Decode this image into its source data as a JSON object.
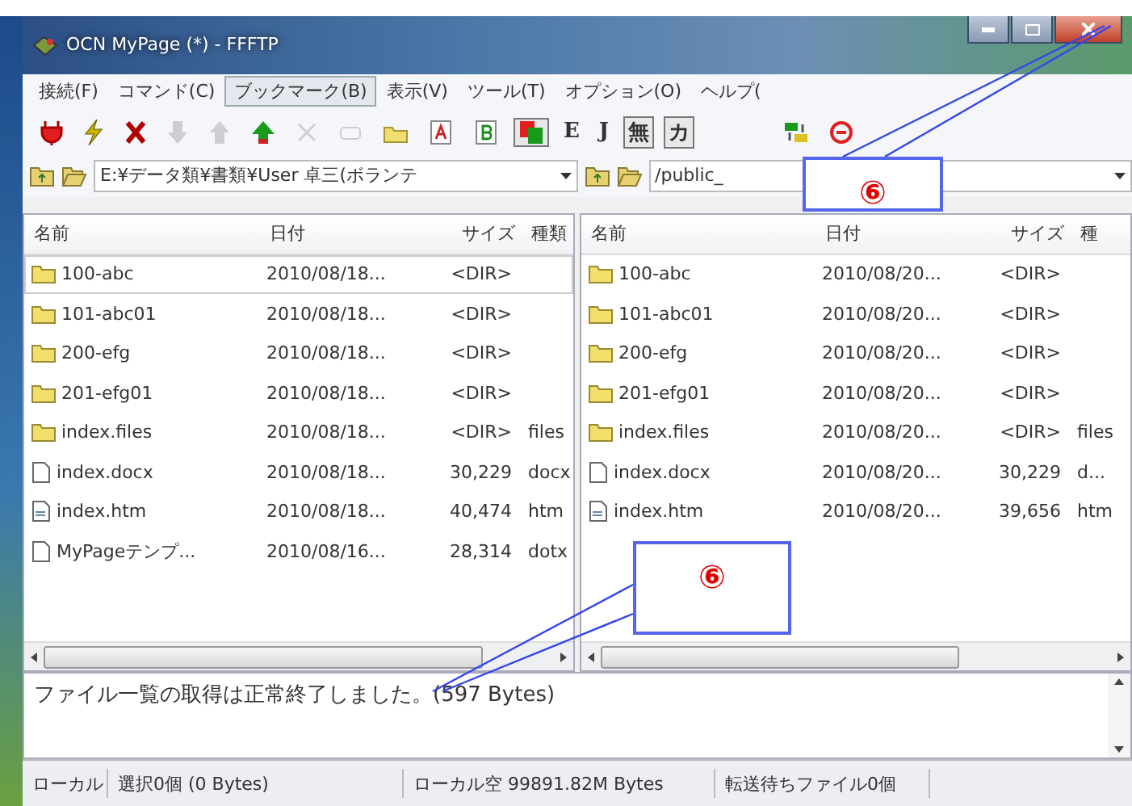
{
  "window": {
    "title": "OCN MyPage (*) - FFFTP"
  },
  "menu": [
    {
      "label": "接続(F)",
      "selected": false
    },
    {
      "label": "コマンド(C)",
      "selected": false
    },
    {
      "label": "ブックマーク(B)",
      "selected": true
    },
    {
      "label": "表示(V)",
      "selected": false
    },
    {
      "label": "ツール(T)",
      "selected": false
    },
    {
      "label": "オプション(O)",
      "selected": false
    },
    {
      "label": "ヘルプ(",
      "selected": false
    }
  ],
  "toolbar": [
    {
      "kind": "connect",
      "disabled": false,
      "pressed": false
    },
    {
      "kind": "quick",
      "disabled": false,
      "pressed": false
    },
    {
      "kind": "disconnect",
      "disabled": false,
      "pressed": false
    },
    {
      "kind": "download",
      "disabled": true,
      "pressed": false
    },
    {
      "kind": "upload",
      "disabled": true,
      "pressed": false
    },
    {
      "kind": "mirror",
      "disabled": false,
      "pressed": false
    },
    {
      "kind": "delete",
      "disabled": true,
      "pressed": false
    },
    {
      "kind": "rename",
      "disabled": true,
      "pressed": false
    },
    {
      "kind": "folder",
      "disabled": false,
      "pressed": false
    },
    {
      "kind": "ascii",
      "disabled": false,
      "pressed": false
    },
    {
      "kind": "binary",
      "disabled": false,
      "pressed": false
    },
    {
      "kind": "auto",
      "disabled": false,
      "pressed": true
    },
    {
      "kind": "text",
      "label": "E",
      "disabled": false,
      "pressed": false
    },
    {
      "kind": "text",
      "label": "J",
      "disabled": false,
      "pressed": false
    },
    {
      "kind": "text",
      "label": "無",
      "disabled": false,
      "pressed": true
    },
    {
      "kind": "text",
      "label": "カ",
      "disabled": false,
      "pressed": true
    },
    {
      "kind": "gap"
    },
    {
      "kind": "sync",
      "disabled": false,
      "pressed": false
    },
    {
      "kind": "stop",
      "disabled": false,
      "pressed": false
    }
  ],
  "local": {
    "path": "E:¥データ類¥書類¥User 卓三(ボランテ",
    "columns": [
      "名前",
      "日付",
      "サイズ",
      "種類"
    ],
    "rows": [
      {
        "kind": "folder",
        "name": "100-abc",
        "date": "2010/08/18...",
        "size": "<DIR>",
        "type": "",
        "focused": true
      },
      {
        "kind": "folder",
        "name": "101-abc01",
        "date": "2010/08/18...",
        "size": "<DIR>",
        "type": "",
        "focused": false
      },
      {
        "kind": "folder",
        "name": "200-efg",
        "date": "2010/08/18...",
        "size": "<DIR>",
        "type": "",
        "focused": false
      },
      {
        "kind": "folder",
        "name": "201-efg01",
        "date": "2010/08/18...",
        "size": "<DIR>",
        "type": "",
        "focused": false
      },
      {
        "kind": "folder",
        "name": "index.files",
        "date": "2010/08/18...",
        "size": "<DIR>",
        "type": "files",
        "focused": false
      },
      {
        "kind": "file",
        "name": "index.docx",
        "date": "2010/08/18...",
        "size": "30,229",
        "type": "docx",
        "focused": false
      },
      {
        "kind": "page",
        "name": "index.htm",
        "date": "2010/08/18...",
        "size": "40,474",
        "type": "htm",
        "focused": false
      },
      {
        "kind": "file",
        "name": "MyPageテンプ...",
        "date": "2010/08/16...",
        "size": "28,314",
        "type": "dotx",
        "focused": false
      }
    ]
  },
  "remote": {
    "path": "/public_",
    "columns": [
      "名前",
      "日付",
      "サイズ",
      "種"
    ],
    "rows": [
      {
        "kind": "folder",
        "name": "100-abc",
        "date": "2010/08/20...",
        "size": "<DIR>",
        "type": "",
        "focused": false
      },
      {
        "kind": "folder",
        "name": "101-abc01",
        "date": "2010/08/20...",
        "size": "<DIR>",
        "type": "",
        "focused": false
      },
      {
        "kind": "folder",
        "name": "200-efg",
        "date": "2010/08/20...",
        "size": "<DIR>",
        "type": "",
        "focused": false
      },
      {
        "kind": "folder",
        "name": "201-efg01",
        "date": "2010/08/20...",
        "size": "<DIR>",
        "type": "",
        "focused": false
      },
      {
        "kind": "folder",
        "name": "index.files",
        "date": "2010/08/20...",
        "size": "<DIR>",
        "type": "files",
        "focused": false
      },
      {
        "kind": "file",
        "name": "index.docx",
        "date": "2010/08/20...",
        "size": "30,229",
        "type": "d...",
        "focused": false
      },
      {
        "kind": "page",
        "name": "index.htm",
        "date": "2010/08/20...",
        "size": "39,656",
        "type": "htm",
        "focused": false
      }
    ]
  },
  "log": "ファイル一覧の取得は正常終了しました。(597 Bytes)",
  "status_bar": [
    "ローカル",
    "選択0個 (0 Bytes)",
    "ローカル空 99891.82M Bytes",
    "転送待ちファイル0個"
  ],
  "callouts": [
    {
      "label": "⑥"
    },
    {
      "label": "⑥"
    }
  ]
}
